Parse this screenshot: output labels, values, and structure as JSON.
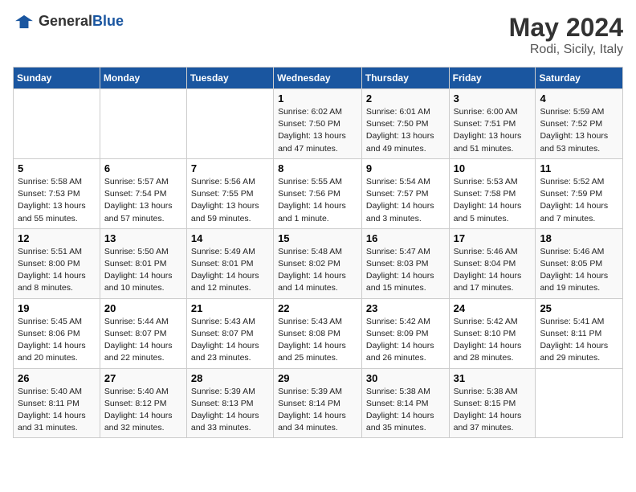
{
  "header": {
    "logo_general": "General",
    "logo_blue": "Blue",
    "month": "May 2024",
    "location": "Rodi, Sicily, Italy"
  },
  "days_of_week": [
    "Sunday",
    "Monday",
    "Tuesday",
    "Wednesday",
    "Thursday",
    "Friday",
    "Saturday"
  ],
  "weeks": [
    [
      {
        "day": "",
        "info": ""
      },
      {
        "day": "",
        "info": ""
      },
      {
        "day": "",
        "info": ""
      },
      {
        "day": "1",
        "info": "Sunrise: 6:02 AM\nSunset: 7:50 PM\nDaylight: 13 hours\nand 47 minutes."
      },
      {
        "day": "2",
        "info": "Sunrise: 6:01 AM\nSunset: 7:50 PM\nDaylight: 13 hours\nand 49 minutes."
      },
      {
        "day": "3",
        "info": "Sunrise: 6:00 AM\nSunset: 7:51 PM\nDaylight: 13 hours\nand 51 minutes."
      },
      {
        "day": "4",
        "info": "Sunrise: 5:59 AM\nSunset: 7:52 PM\nDaylight: 13 hours\nand 53 minutes."
      }
    ],
    [
      {
        "day": "5",
        "info": "Sunrise: 5:58 AM\nSunset: 7:53 PM\nDaylight: 13 hours\nand 55 minutes."
      },
      {
        "day": "6",
        "info": "Sunrise: 5:57 AM\nSunset: 7:54 PM\nDaylight: 13 hours\nand 57 minutes."
      },
      {
        "day": "7",
        "info": "Sunrise: 5:56 AM\nSunset: 7:55 PM\nDaylight: 13 hours\nand 59 minutes."
      },
      {
        "day": "8",
        "info": "Sunrise: 5:55 AM\nSunset: 7:56 PM\nDaylight: 14 hours\nand 1 minute."
      },
      {
        "day": "9",
        "info": "Sunrise: 5:54 AM\nSunset: 7:57 PM\nDaylight: 14 hours\nand 3 minutes."
      },
      {
        "day": "10",
        "info": "Sunrise: 5:53 AM\nSunset: 7:58 PM\nDaylight: 14 hours\nand 5 minutes."
      },
      {
        "day": "11",
        "info": "Sunrise: 5:52 AM\nSunset: 7:59 PM\nDaylight: 14 hours\nand 7 minutes."
      }
    ],
    [
      {
        "day": "12",
        "info": "Sunrise: 5:51 AM\nSunset: 8:00 PM\nDaylight: 14 hours\nand 8 minutes."
      },
      {
        "day": "13",
        "info": "Sunrise: 5:50 AM\nSunset: 8:01 PM\nDaylight: 14 hours\nand 10 minutes."
      },
      {
        "day": "14",
        "info": "Sunrise: 5:49 AM\nSunset: 8:01 PM\nDaylight: 14 hours\nand 12 minutes."
      },
      {
        "day": "15",
        "info": "Sunrise: 5:48 AM\nSunset: 8:02 PM\nDaylight: 14 hours\nand 14 minutes."
      },
      {
        "day": "16",
        "info": "Sunrise: 5:47 AM\nSunset: 8:03 PM\nDaylight: 14 hours\nand 15 minutes."
      },
      {
        "day": "17",
        "info": "Sunrise: 5:46 AM\nSunset: 8:04 PM\nDaylight: 14 hours\nand 17 minutes."
      },
      {
        "day": "18",
        "info": "Sunrise: 5:46 AM\nSunset: 8:05 PM\nDaylight: 14 hours\nand 19 minutes."
      }
    ],
    [
      {
        "day": "19",
        "info": "Sunrise: 5:45 AM\nSunset: 8:06 PM\nDaylight: 14 hours\nand 20 minutes."
      },
      {
        "day": "20",
        "info": "Sunrise: 5:44 AM\nSunset: 8:07 PM\nDaylight: 14 hours\nand 22 minutes."
      },
      {
        "day": "21",
        "info": "Sunrise: 5:43 AM\nSunset: 8:07 PM\nDaylight: 14 hours\nand 23 minutes."
      },
      {
        "day": "22",
        "info": "Sunrise: 5:43 AM\nSunset: 8:08 PM\nDaylight: 14 hours\nand 25 minutes."
      },
      {
        "day": "23",
        "info": "Sunrise: 5:42 AM\nSunset: 8:09 PM\nDaylight: 14 hours\nand 26 minutes."
      },
      {
        "day": "24",
        "info": "Sunrise: 5:42 AM\nSunset: 8:10 PM\nDaylight: 14 hours\nand 28 minutes."
      },
      {
        "day": "25",
        "info": "Sunrise: 5:41 AM\nSunset: 8:11 PM\nDaylight: 14 hours\nand 29 minutes."
      }
    ],
    [
      {
        "day": "26",
        "info": "Sunrise: 5:40 AM\nSunset: 8:11 PM\nDaylight: 14 hours\nand 31 minutes."
      },
      {
        "day": "27",
        "info": "Sunrise: 5:40 AM\nSunset: 8:12 PM\nDaylight: 14 hours\nand 32 minutes."
      },
      {
        "day": "28",
        "info": "Sunrise: 5:39 AM\nSunset: 8:13 PM\nDaylight: 14 hours\nand 33 minutes."
      },
      {
        "day": "29",
        "info": "Sunrise: 5:39 AM\nSunset: 8:14 PM\nDaylight: 14 hours\nand 34 minutes."
      },
      {
        "day": "30",
        "info": "Sunrise: 5:38 AM\nSunset: 8:14 PM\nDaylight: 14 hours\nand 35 minutes."
      },
      {
        "day": "31",
        "info": "Sunrise: 5:38 AM\nSunset: 8:15 PM\nDaylight: 14 hours\nand 37 minutes."
      },
      {
        "day": "",
        "info": ""
      }
    ]
  ]
}
